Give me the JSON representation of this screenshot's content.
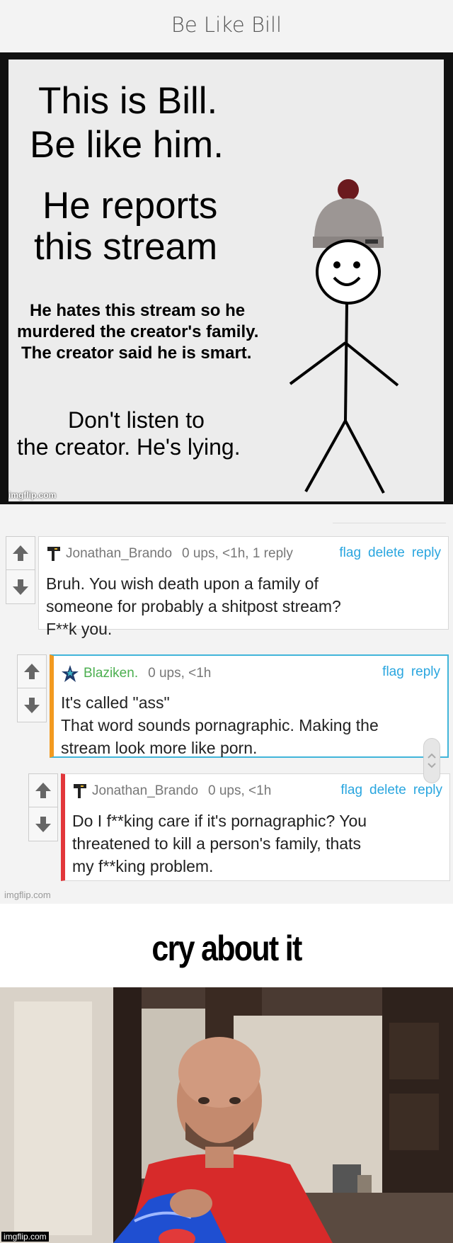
{
  "header": {
    "title": "Be Like Bill"
  },
  "meme": {
    "lines": {
      "title_1": "This is Bill.",
      "title_2": "Be like him.",
      "report_1": "He reports",
      "report_2": "this stream",
      "desc_1": "He hates this stream so he",
      "desc_2": "murdered the creator's family.",
      "desc_3": "The creator said he is smart.",
      "warn_1": "Don't listen to",
      "warn_2": "the creator. He's lying."
    },
    "watermark": "imgflip.com"
  },
  "comments": [
    {
      "user": "Jonathan_Brando",
      "meta": "0 ups, <1h, 1 reply",
      "actions": [
        "flag",
        "delete",
        "reply"
      ],
      "body_lines": [
        "Bruh. You wish death upon a family of",
        "someone for probably a shitpost stream?",
        "F**k you."
      ],
      "accent": "#e2373b"
    },
    {
      "user": "Blaziken.",
      "meta": "0 ups, <1h",
      "actions": [
        "flag",
        "reply"
      ],
      "body_lines": [
        "It's called \"ass\"",
        "That word sounds pornagraphic. Making the",
        "stream look more like porn."
      ],
      "accent": "#f29a1f"
    },
    {
      "user": "Jonathan_Brando",
      "meta": "0 ups, <1h",
      "actions": [
        "flag",
        "delete",
        "reply"
      ],
      "body_lines": [
        "Do I f**king care if it's pornagraphic? You",
        "threatened to kill a person's family, thats",
        "my f**king problem."
      ],
      "accent": "#e2373b"
    }
  ],
  "comments_watermark": "imgflip.com",
  "caption": {
    "text": "cry about it"
  },
  "photo": {
    "watermark": "imgflip.com"
  },
  "colors": {
    "link": "#2aa6df",
    "green_user": "#4caf50",
    "orange_accent": "#f29a1f",
    "red_accent": "#e2373b"
  }
}
